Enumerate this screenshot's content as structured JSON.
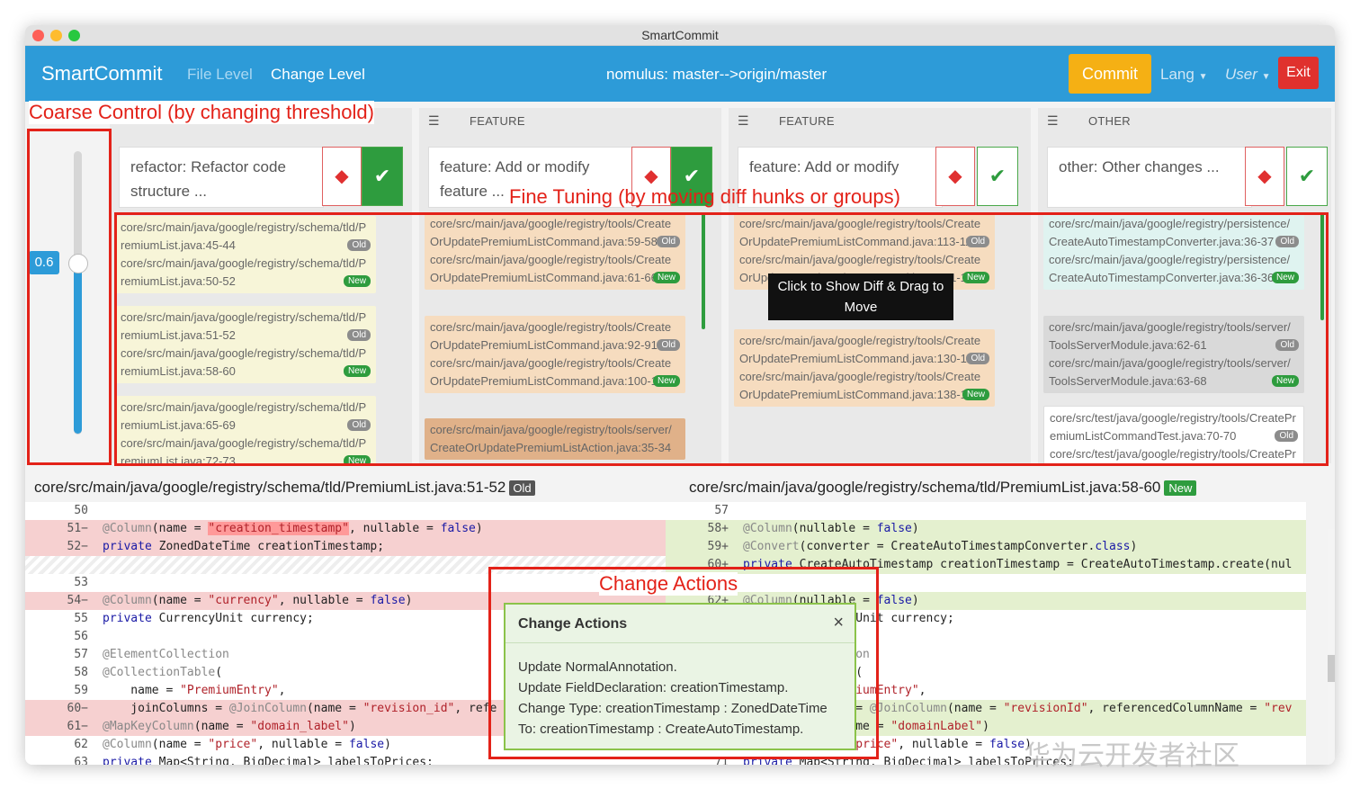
{
  "window": {
    "title": "SmartCommit"
  },
  "navbar": {
    "brand": "SmartCommit",
    "links": [
      "File Level",
      "Change Level"
    ],
    "repo": "nomulus: master-->origin/master",
    "commit": "Commit",
    "lang": "Lang",
    "user": "User",
    "exit": "Exit"
  },
  "annotations": {
    "coarse": "Coarse Control (by changing threshold)",
    "fine": "Fine Tuning (by moving diff hunks or groups)",
    "change": "Change Actions"
  },
  "slider": {
    "value": "0.6",
    "level": 0.6
  },
  "columns": [
    {
      "header": "",
      "group": "refactor: Refactor code structure ...",
      "cards": [
        {
          "color": "yellow",
          "lines": [
            "core/src/main/java/google/registry/schema/tld/P",
            "remiumList.java:45-44",
            "core/src/main/java/google/registry/schema/tld/P",
            "remiumList.java:50-52"
          ],
          "badges": [
            "Old",
            "New"
          ]
        },
        {
          "color": "yellow",
          "lines": [
            "core/src/main/java/google/registry/schema/tld/P",
            "remiumList.java:51-52",
            "core/src/main/java/google/registry/schema/tld/P",
            "remiumList.java:58-60"
          ],
          "badges": [
            "Old",
            "New"
          ]
        },
        {
          "color": "yellow",
          "lines": [
            "core/src/main/java/google/registry/schema/tld/P",
            "remiumList.java:65-69",
            "core/src/main/java/google/registry/schema/tld/P",
            "remiumList.java:72-73"
          ],
          "badges": [
            "Old",
            "New"
          ]
        }
      ]
    },
    {
      "header": "FEATURE",
      "group": "feature: Add or modify feature ...",
      "cards": [
        {
          "color": "orange",
          "lines": [
            "core/src/main/java/google/registry/tools/Create",
            "OrUpdatePremiumListCommand.java:59-58",
            "core/src/main/java/google/registry/tools/Create",
            "OrUpdatePremiumListCommand.java:61-66"
          ],
          "badges": [
            "Old",
            "New"
          ]
        },
        {
          "color": "orange",
          "lines": [
            "core/src/main/java/google/registry/tools/Create",
            "OrUpdatePremiumListCommand.java:92-91",
            "core/src/main/java/google/registry/tools/Create",
            "OrUpdatePremiumListCommand.java:100-100"
          ],
          "badges": [
            "Old",
            "New"
          ]
        },
        {
          "color": "brown",
          "lines": [
            "core/src/main/java/google/registry/tools/server/",
            "CreateOrUpdatePremiumListAction.java:35-34"
          ],
          "badges": []
        }
      ]
    },
    {
      "header": "FEATURE",
      "group": "feature: Add or modify",
      "cards": [
        {
          "color": "orange",
          "lines": [
            "core/src/main/java/google/registry/tools/Create",
            "OrUpdatePremiumListCommand.java:113-113",
            "core/src/main/java/google/registry/tools/Create",
            "OrUpdatePremiumListCommand.java:121-121"
          ],
          "badges": [
            "Old",
            "New"
          ]
        },
        {
          "color": "orange",
          "lines": [
            "core/src/main/java/google/registry/tools/Create",
            "OrUpdatePremiumListCommand.java:130-130",
            "core/src/main/java/google/registry/tools/Create",
            "OrUpdatePremiumListCommand.java:138-138"
          ],
          "badges": [
            "Old",
            "New"
          ]
        }
      ]
    },
    {
      "header": "OTHER",
      "group": "other: Other changes ...",
      "cards": [
        {
          "color": "cyan",
          "lines": [
            "core/src/main/java/google/registry/persistence/",
            "CreateAutoTimestampConverter.java:36-37",
            "core/src/main/java/google/registry/persistence/",
            "CreateAutoTimestampConverter.java:36-36"
          ],
          "badges": [
            "Old",
            "New"
          ]
        },
        {
          "color": "gray",
          "lines": [
            "core/src/main/java/google/registry/tools/server/",
            "ToolsServerModule.java:62-61",
            "core/src/main/java/google/registry/tools/server/",
            "ToolsServerModule.java:63-68"
          ],
          "badges": [
            "Old",
            "New"
          ]
        },
        {
          "color": "white",
          "lines": [
            "core/src/test/java/google/registry/tools/CreatePr",
            "emiumListCommandTest.java:70-70",
            "core/src/test/java/google/registry/tools/CreatePr"
          ],
          "badges": [
            "Old"
          ]
        }
      ]
    }
  ],
  "tooltip": {
    "line1": "Click to Show Diff & Drag to",
    "line2": "Move"
  },
  "diff": {
    "left_title": "core/src/main/java/google/registry/schema/tld/PremiumList.java:51-52",
    "left_tag": "Old",
    "right_title": "core/src/main/java/google/registry/schema/tld/PremiumList.java:58-60",
    "right_tag": "New"
  },
  "popup": {
    "title": "Change Actions",
    "close": "×",
    "lines": [
      "Update NormalAnnotation.",
      "Update FieldDeclaration: creationTimestamp.",
      "Change Type: creationTimestamp : ZonedDateTime",
      "To: creationTimestamp : CreateAutoTimestamp."
    ]
  },
  "watermark": "华为云开发者社区",
  "colors": {
    "accent": "#2d9bd8",
    "commit": "#f5b014",
    "exit": "#e0312e",
    "annotation": "#e32219",
    "new": "#2e9c3e"
  }
}
